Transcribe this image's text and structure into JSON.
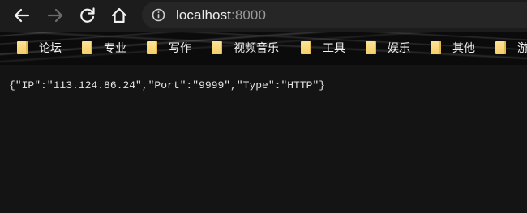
{
  "toolbar": {
    "back_icon": "arrow-left-icon",
    "forward_icon": "arrow-right-icon",
    "reload_icon": "reload-icon",
    "home_icon": "home-icon",
    "info_icon": "info-icon"
  },
  "address": {
    "host": "localhost",
    "port": ":8000"
  },
  "bookmarks": [
    {
      "label": "论坛",
      "icon": "folder-icon"
    },
    {
      "label": "专业",
      "icon": "folder-icon"
    },
    {
      "label": "写作",
      "icon": "folder-icon"
    },
    {
      "label": "视频音乐",
      "icon": "folder-icon"
    },
    {
      "label": "工具",
      "icon": "folder-icon"
    },
    {
      "label": "娱乐",
      "icon": "folder-icon"
    },
    {
      "label": "其他",
      "icon": "folder-icon"
    },
    {
      "label": "游",
      "icon": "folder-icon"
    }
  ],
  "page": {
    "json_text": "{\"IP\":\"113.124.86.24\",\"Port\":\"9999\",\"Type\":\"HTTP\"}"
  },
  "colors": {
    "toolbar_bg": "#1c1c1c",
    "address_bg": "#262626",
    "page_bg": "#141414",
    "folder": "#f5cf63"
  }
}
